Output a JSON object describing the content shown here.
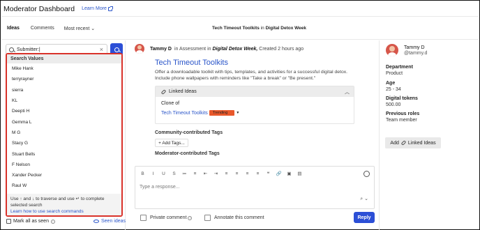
{
  "header": {
    "title": "Moderator Dashboard",
    "learn_more": "Learn More"
  },
  "subbar": {
    "tabs": [
      "Ideas",
      "Comments"
    ],
    "sort": "Most recent",
    "thread_title": "Tech Timeout Toolkits",
    "thread_in": "in",
    "thread_location": "Digital Detox Week"
  },
  "search": {
    "value": "Submitter:|",
    "dropdown_header": "Search Values",
    "options": [
      "Mike Hank",
      "terryrayner",
      "sierra",
      "KL",
      "Deepti H",
      "Gemma L",
      "M G",
      "Stacy G",
      "Stuart Bells",
      "F Nelson",
      "Xander Pecker",
      "Raul W"
    ],
    "hint": "Use ↑ and ↓ to traverse and use ↵ to complete selected search",
    "learn_link": "Learn how to use search commands"
  },
  "footer_left": {
    "mark_all": "Mark all as seen",
    "seen_ideas": "Seen ideas"
  },
  "post": {
    "author": "Tammy D",
    "meta_prefix": "in Assessment in",
    "meta_location": "Digital Detox Week,",
    "meta_suffix": "Created 2 hours ago",
    "title": "Tech Timeout Toolkits",
    "description": "Offer a downloadable toolkit with tips, templates, and activities for a successful digital detox. Include phone wallpapers with reminders like \"Take a break\" or \"Be present.\"",
    "linked_ideas_label": "Linked Ideas",
    "clone_of": "Clone of",
    "linked_title": "Tech Timeout Toolkits",
    "trending": "Trending",
    "community_tags": "Community-contributed Tags",
    "add_tags": "+ Add Tags...",
    "moderator_tags": "Moderator-contributed Tags"
  },
  "editor": {
    "toolbar": [
      "B",
      "I",
      "U",
      "S",
      "≔",
      "≡",
      "⇤",
      "⇥",
      "≡",
      "≡",
      "≡",
      "≡",
      "❝",
      "🔗",
      "▣",
      "▤"
    ],
    "placeholder": "Type a response...",
    "private_comment": "Private comment",
    "annotate": "Annotate this comment",
    "reply": "Reply"
  },
  "profile": {
    "name": "Tammy D",
    "handle": "@tammy.d",
    "fields": [
      {
        "label": "Department",
        "value": "Product"
      },
      {
        "label": "Age",
        "value": "25 - 34"
      },
      {
        "label": "Digital tokens",
        "value": "500.00"
      },
      {
        "label": "Previous roles",
        "value": "Team member"
      }
    ],
    "add_linked": "Add",
    "add_linked_suffix": "Linked Ideas"
  },
  "colors": {
    "accent": "#2c4fd6",
    "link": "#2a55c9",
    "highlight_border": "#d9322a",
    "trending": "#e8582b"
  }
}
